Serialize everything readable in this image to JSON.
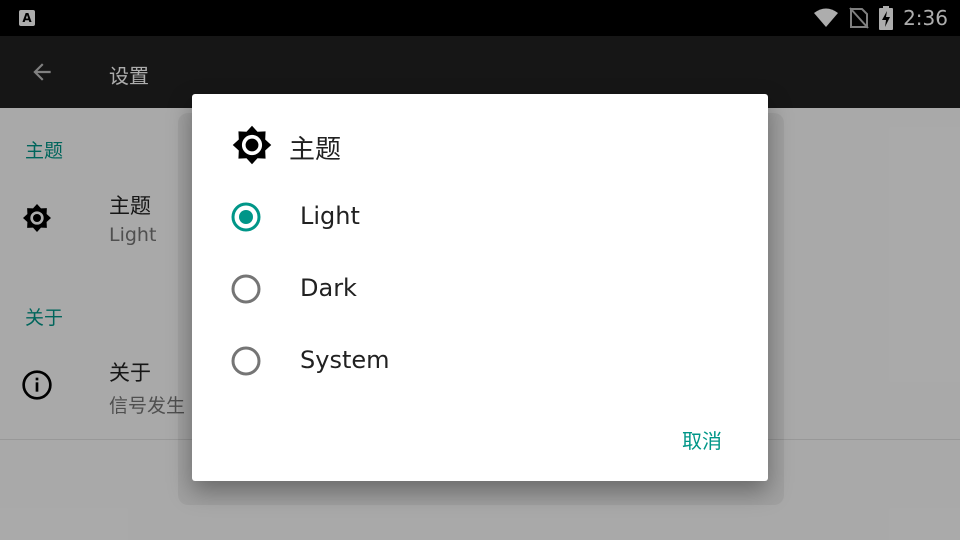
{
  "statusbar": {
    "app_icon": "A",
    "icons": [
      "wifi-icon",
      "no-sim-icon",
      "battery-charging-icon"
    ],
    "time": "2:36"
  },
  "appbar": {
    "back_icon": "arrow-back-icon",
    "title": "设置"
  },
  "settings": {
    "sections": [
      {
        "header": "主题",
        "item": {
          "icon": "brightness-icon",
          "title": "主题",
          "summary": "Light"
        }
      },
      {
        "header": "关于",
        "item": {
          "icon": "info-icon",
          "title": "关于",
          "summary": "信号发生"
        }
      }
    ]
  },
  "dialog": {
    "icon": "brightness-icon",
    "title": "主题",
    "options": [
      {
        "label": "Light",
        "selected": true
      },
      {
        "label": "Dark",
        "selected": false
      },
      {
        "label": "System",
        "selected": false
      }
    ],
    "cancel_label": "取消"
  },
  "colors": {
    "accent": "#009688",
    "appbar": "#212121",
    "statusbar": "#000000",
    "radio_unselected": "#757575"
  }
}
